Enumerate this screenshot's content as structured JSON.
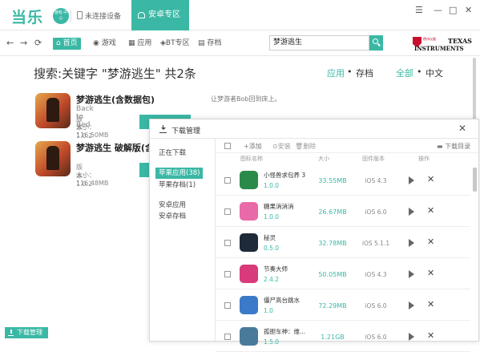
{
  "titlebar": {
    "logo_text": "当乐",
    "logo_badge": "游戏 中心",
    "device_status": "未连接设备",
    "android_zone": "安卓专区",
    "window_controls": {
      "skin": "☰",
      "minimize": "—",
      "maximize": "□",
      "close": "✕"
    }
  },
  "nav": {
    "back": "←",
    "forward": "→",
    "refresh": "⟳",
    "tabs": [
      {
        "label": "首页",
        "icon": "home-icon",
        "active": true
      },
      {
        "label": "游戏",
        "icon": "gamepad-icon",
        "active": false
      },
      {
        "label": "应用",
        "icon": "apps-icon",
        "active": false
      },
      {
        "label": "BT专区",
        "icon": "bt-icon",
        "active": false
      },
      {
        "label": "存档",
        "icon": "save-icon",
        "active": false
      }
    ],
    "search_value": "梦游逃生"
  },
  "sponsor": {
    "cn": "德州仪器",
    "line1": "TEXAS",
    "line2": "INSTRUMENTS"
  },
  "search_result": {
    "title": "搜索:关键字 \"梦游逃生\" 共2条",
    "filter_type": {
      "app": "应用",
      "sep": "•",
      "save": "存档"
    },
    "filter_lang": {
      "all": "全部",
      "sep": "•",
      "cn": "中文"
    }
  },
  "results": [
    {
      "name": "梦游逃生(含数据包)",
      "subtitle": "Back to Bed",
      "version": "版本：1.0.2",
      "size": "大小：116.50MB",
      "desc": "让梦游者Bob回到床上。"
    },
    {
      "name": "梦游逃生 破解版(含",
      "subtitle": "",
      "version": "版本：1.0.2",
      "size": "大小：116.48MB",
      "desc": ""
    }
  ],
  "bottom_button": "下载管理",
  "download_manager": {
    "title": "下载管理",
    "close": "✕",
    "sidebar": {
      "downloading": "正在下载",
      "apple_apps": "苹果应用(38)",
      "apple_saves": "苹果存档(1)",
      "android_apps": "安卓应用",
      "android_saves": "安卓存档"
    },
    "toolbar": {
      "add": "+添加",
      "install": "安装",
      "delete": "删除",
      "folder": "下载目录"
    },
    "columns": {
      "icon": "图标名称",
      "size": "大小",
      "firmware": "固件版本",
      "action": "操作"
    },
    "rows": [
      {
        "name": "小怪兽求包养 3",
        "version": "1.0.0",
        "size": "33.55MB",
        "os": "iOS 4.3",
        "icon_color": "#2a8a4a"
      },
      {
        "name": "糖果消消消",
        "version": "1.0.0",
        "size": "26.67MB",
        "os": "iOS 6.0",
        "icon_color": "#e86aa8"
      },
      {
        "name": "秘灵",
        "version": "0.5.0",
        "size": "32.78MB",
        "os": "iOS 5.1.1",
        "icon_color": "#1e2a3a"
      },
      {
        "name": "节奏大师",
        "version": "2.4.2",
        "size": "50.05MB",
        "os": "iOS 4.3",
        "icon_color": "#d83a7a"
      },
      {
        "name": "僵尸高台跳水",
        "version": "1.0",
        "size": "72.29MB",
        "os": "iOS 6.0",
        "icon_color": "#3a7ac8"
      },
      {
        "name": "孤胆车神：维...",
        "version": "1.5.0",
        "size": "1.21GB",
        "os": "iOS 6.0",
        "icon_color": "#4a7a9a"
      }
    ]
  }
}
